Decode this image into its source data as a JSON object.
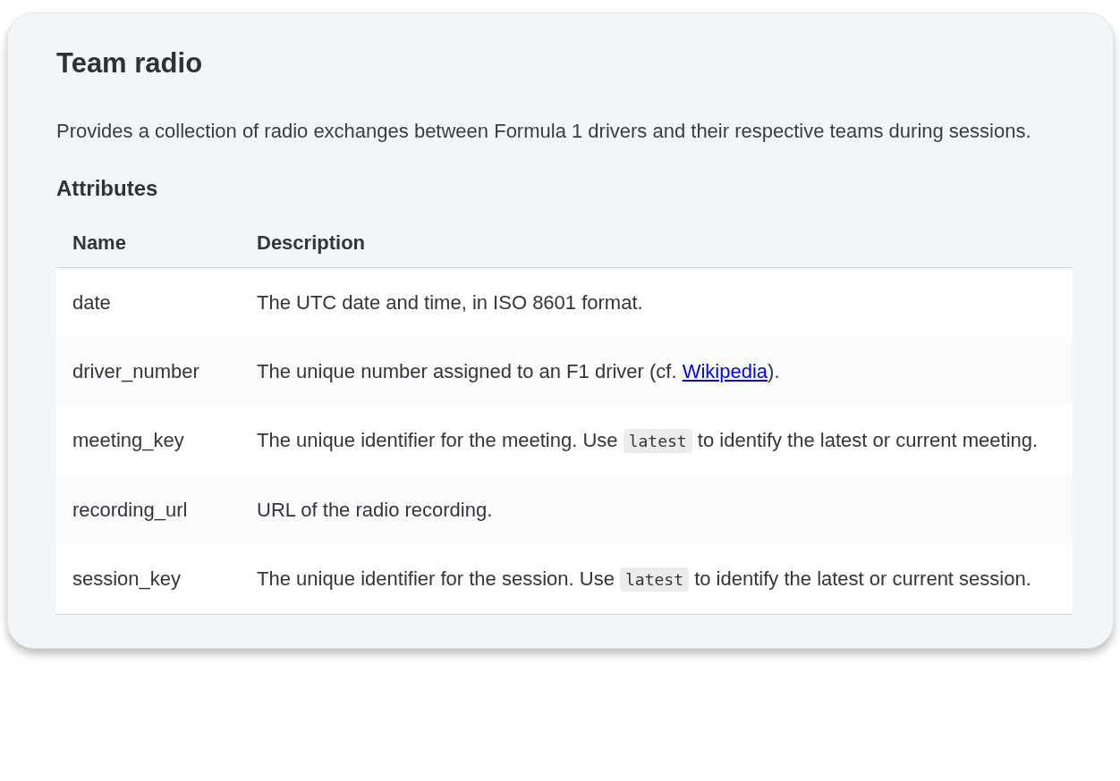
{
  "title": "Team radio",
  "description": "Provides a collection of radio exchanges between Formula 1 drivers and their respective teams during sessions.",
  "section_heading": "Attributes",
  "table": {
    "columns": [
      "Name",
      "Description"
    ],
    "rows": [
      {
        "name": "date",
        "description": [
          {
            "kind": "text",
            "text": "The UTC date and time, in ISO 8601 format."
          }
        ]
      },
      {
        "name": "driver_number",
        "description": [
          {
            "kind": "text",
            "text": "The unique number assigned to an F1 driver (cf. "
          },
          {
            "kind": "link",
            "text": "Wikipedia"
          },
          {
            "kind": "text",
            "text": ")."
          }
        ]
      },
      {
        "name": "meeting_key",
        "description": [
          {
            "kind": "text",
            "text": "The unique identifier for the meeting. Use "
          },
          {
            "kind": "code",
            "text": "latest"
          },
          {
            "kind": "text",
            "text": " to identify the latest or current meeting."
          }
        ]
      },
      {
        "name": "recording_url",
        "description": [
          {
            "kind": "text",
            "text": "URL of the radio recording."
          }
        ]
      },
      {
        "name": "session_key",
        "description": [
          {
            "kind": "text",
            "text": "The unique identifier for the session. Use "
          },
          {
            "kind": "code",
            "text": "latest"
          },
          {
            "kind": "text",
            "text": " to identify the latest or current session."
          }
        ]
      }
    ]
  }
}
